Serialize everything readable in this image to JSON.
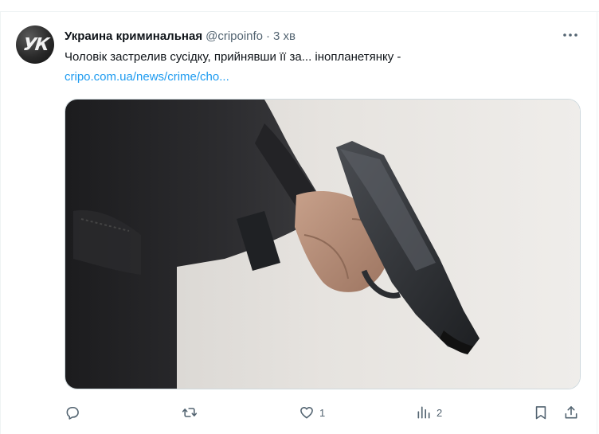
{
  "tweet": {
    "avatar_text": "УК",
    "display_name": "Украина криминальная",
    "handle": "@cripoinfo",
    "separator": "·",
    "time": "3 хв",
    "text": "Чоловік застрелив сусідку, прийнявши її за... інопланетянку -",
    "link": "cripo.com.ua/news/crime/cho..."
  },
  "actions": {
    "reply_count": "",
    "retweet_count": "",
    "like_count": "1",
    "views_count": "2"
  },
  "icons": {
    "more": "more-horizontal-icon",
    "reply": "reply-icon",
    "retweet": "retweet-icon",
    "like": "heart-icon",
    "views": "views-chart-icon",
    "bookmark": "bookmark-icon",
    "share": "share-icon"
  },
  "colors": {
    "text": "#0f1419",
    "secondary": "#536471",
    "link": "#1d9bf0",
    "border": "#cfd9de"
  }
}
